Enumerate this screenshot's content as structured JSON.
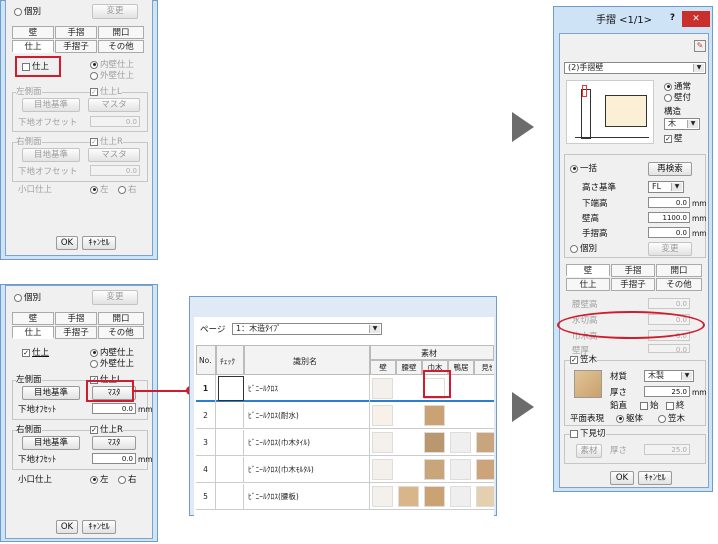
{
  "left_top_dialog": {
    "radio_individual": "個別",
    "change_btn": "変更",
    "tabs_row1": [
      "壁",
      "手摺",
      "開口"
    ],
    "tabs_row2": [
      "仕上",
      "手摺子",
      "その他"
    ],
    "finish_check": "仕上",
    "radio_inner": "内壁仕上",
    "radio_outer": "外壁仕上",
    "left_side_label": "左側面",
    "finish_l": "仕上L",
    "joint_btn": "目地基準",
    "master_btn": "マスタ",
    "offset_label": "下地オフセット",
    "offset_value": "0.0",
    "right_side_label": "右側面",
    "finish_r": "仕上R",
    "small_finish": "小口仕上",
    "radio_left": "左",
    "radio_right": "右",
    "ok": "OK",
    "cancel": "ｷｬﾝｾﾙ"
  },
  "left_bottom_dialog": {
    "radio_individual": "個別",
    "change_btn": "変更",
    "tabs_row1": [
      "壁",
      "手摺",
      "開口"
    ],
    "tabs_row2": [
      "仕上",
      "手摺子",
      "その他"
    ],
    "finish_check": "仕上",
    "radio_inner": "内壁仕上",
    "radio_outer": "外壁仕上",
    "left_side_label": "左側面",
    "finish_l": "仕上L",
    "joint_btn": "目地基準",
    "master_btn": "ﾏｽﾀ",
    "offset_label": "下地ｵﾌｾｯﾄ",
    "offset_value": "0.0",
    "unit": "mm",
    "right_side_label": "右側面",
    "finish_r": "仕上R",
    "small_finish": "小口仕上",
    "radio_left": "左",
    "radio_right": "右",
    "ok": "OK",
    "cancel": "ｷｬﾝｾﾙ"
  },
  "material_table": {
    "page_label": "ページ",
    "page_value": "1：木造ﾀｲﾌﾟ",
    "headers": {
      "no": "No.",
      "check": "ﾁｪｯｸ",
      "name": "識別名",
      "material": "素材"
    },
    "sub_headers": [
      "壁",
      "腰壁",
      "巾木",
      "鴨居",
      "見ｾ"
    ],
    "rows": [
      {
        "no": "1",
        "name": "ﾋﾞﾆｰﾙｸﾛｽ"
      },
      {
        "no": "2",
        "name": "ﾋﾞﾆｰﾙｸﾛｽ(耐水)"
      },
      {
        "no": "3",
        "name": "ﾋﾞﾆｰﾙｸﾛｽ(巾木ﾀｲﾙ)"
      },
      {
        "no": "4",
        "name": "ﾋﾞﾆｰﾙｸﾛｽ(巾木ﾓﾙﾀﾙ)"
      },
      {
        "no": "5",
        "name": "ﾋﾞﾆｰﾙｸﾛｽ(腰板)"
      }
    ]
  },
  "right_dialog": {
    "title": "手摺 <1/1>",
    "help": "?",
    "close": "✕",
    "wall_select": "(2)手摺壁",
    "radio_normal": "通常",
    "radio_wallmount": "壁付",
    "structure_label": "構造",
    "structure_value": "木",
    "wall_check": "壁",
    "radio_bulk": "一括",
    "research_btn": "再検索",
    "height_base_label": "高さ基準",
    "height_base_value": "FL",
    "bottom_height_label": "下端高",
    "bottom_height_value": "0.0",
    "wall_height_label": "壁高",
    "wall_height_value": "1100.0",
    "rail_height_label": "手摺高",
    "rail_height_value": "0.0",
    "unit": "mm",
    "radio_individual": "個別",
    "change_btn": "変更",
    "tabs_row1": [
      "壁",
      "手摺",
      "開口"
    ],
    "tabs_row2": [
      "仕上",
      "手摺子",
      "その他"
    ],
    "waist_wall_label": "腰壁高",
    "waist_wall_value": "0.0",
    "dado_label": "水切高",
    "dado_value": "0.0",
    "baseboard_label": "巾木高",
    "baseboard_value": "0.0",
    "thickness_partial_label": "壁厚",
    "thickness_partial_value": "0.0",
    "kasagi_check": "笠木",
    "material_label": "材質",
    "material_value": "木製",
    "thickness_label": "厚さ",
    "thickness_value": "25.0",
    "edge_label": "鉛直",
    "edge_start": "始",
    "edge_end": "終",
    "plan_label": "平面表現",
    "plan_wall": "躯体",
    "plan_kasagi": "笠木",
    "mikiri_check": "下見切",
    "sozai_btn": "素材",
    "mikiri_thick_label": "厚さ",
    "mikiri_thick_value": "25.0",
    "ok": "OK",
    "cancel": "ｷｬﾝｾﾙ"
  },
  "colors": {
    "highlight_red": "#d01c2c",
    "arrow_gray": "#6c6c6c",
    "select_blue": "#2a7fd4"
  }
}
